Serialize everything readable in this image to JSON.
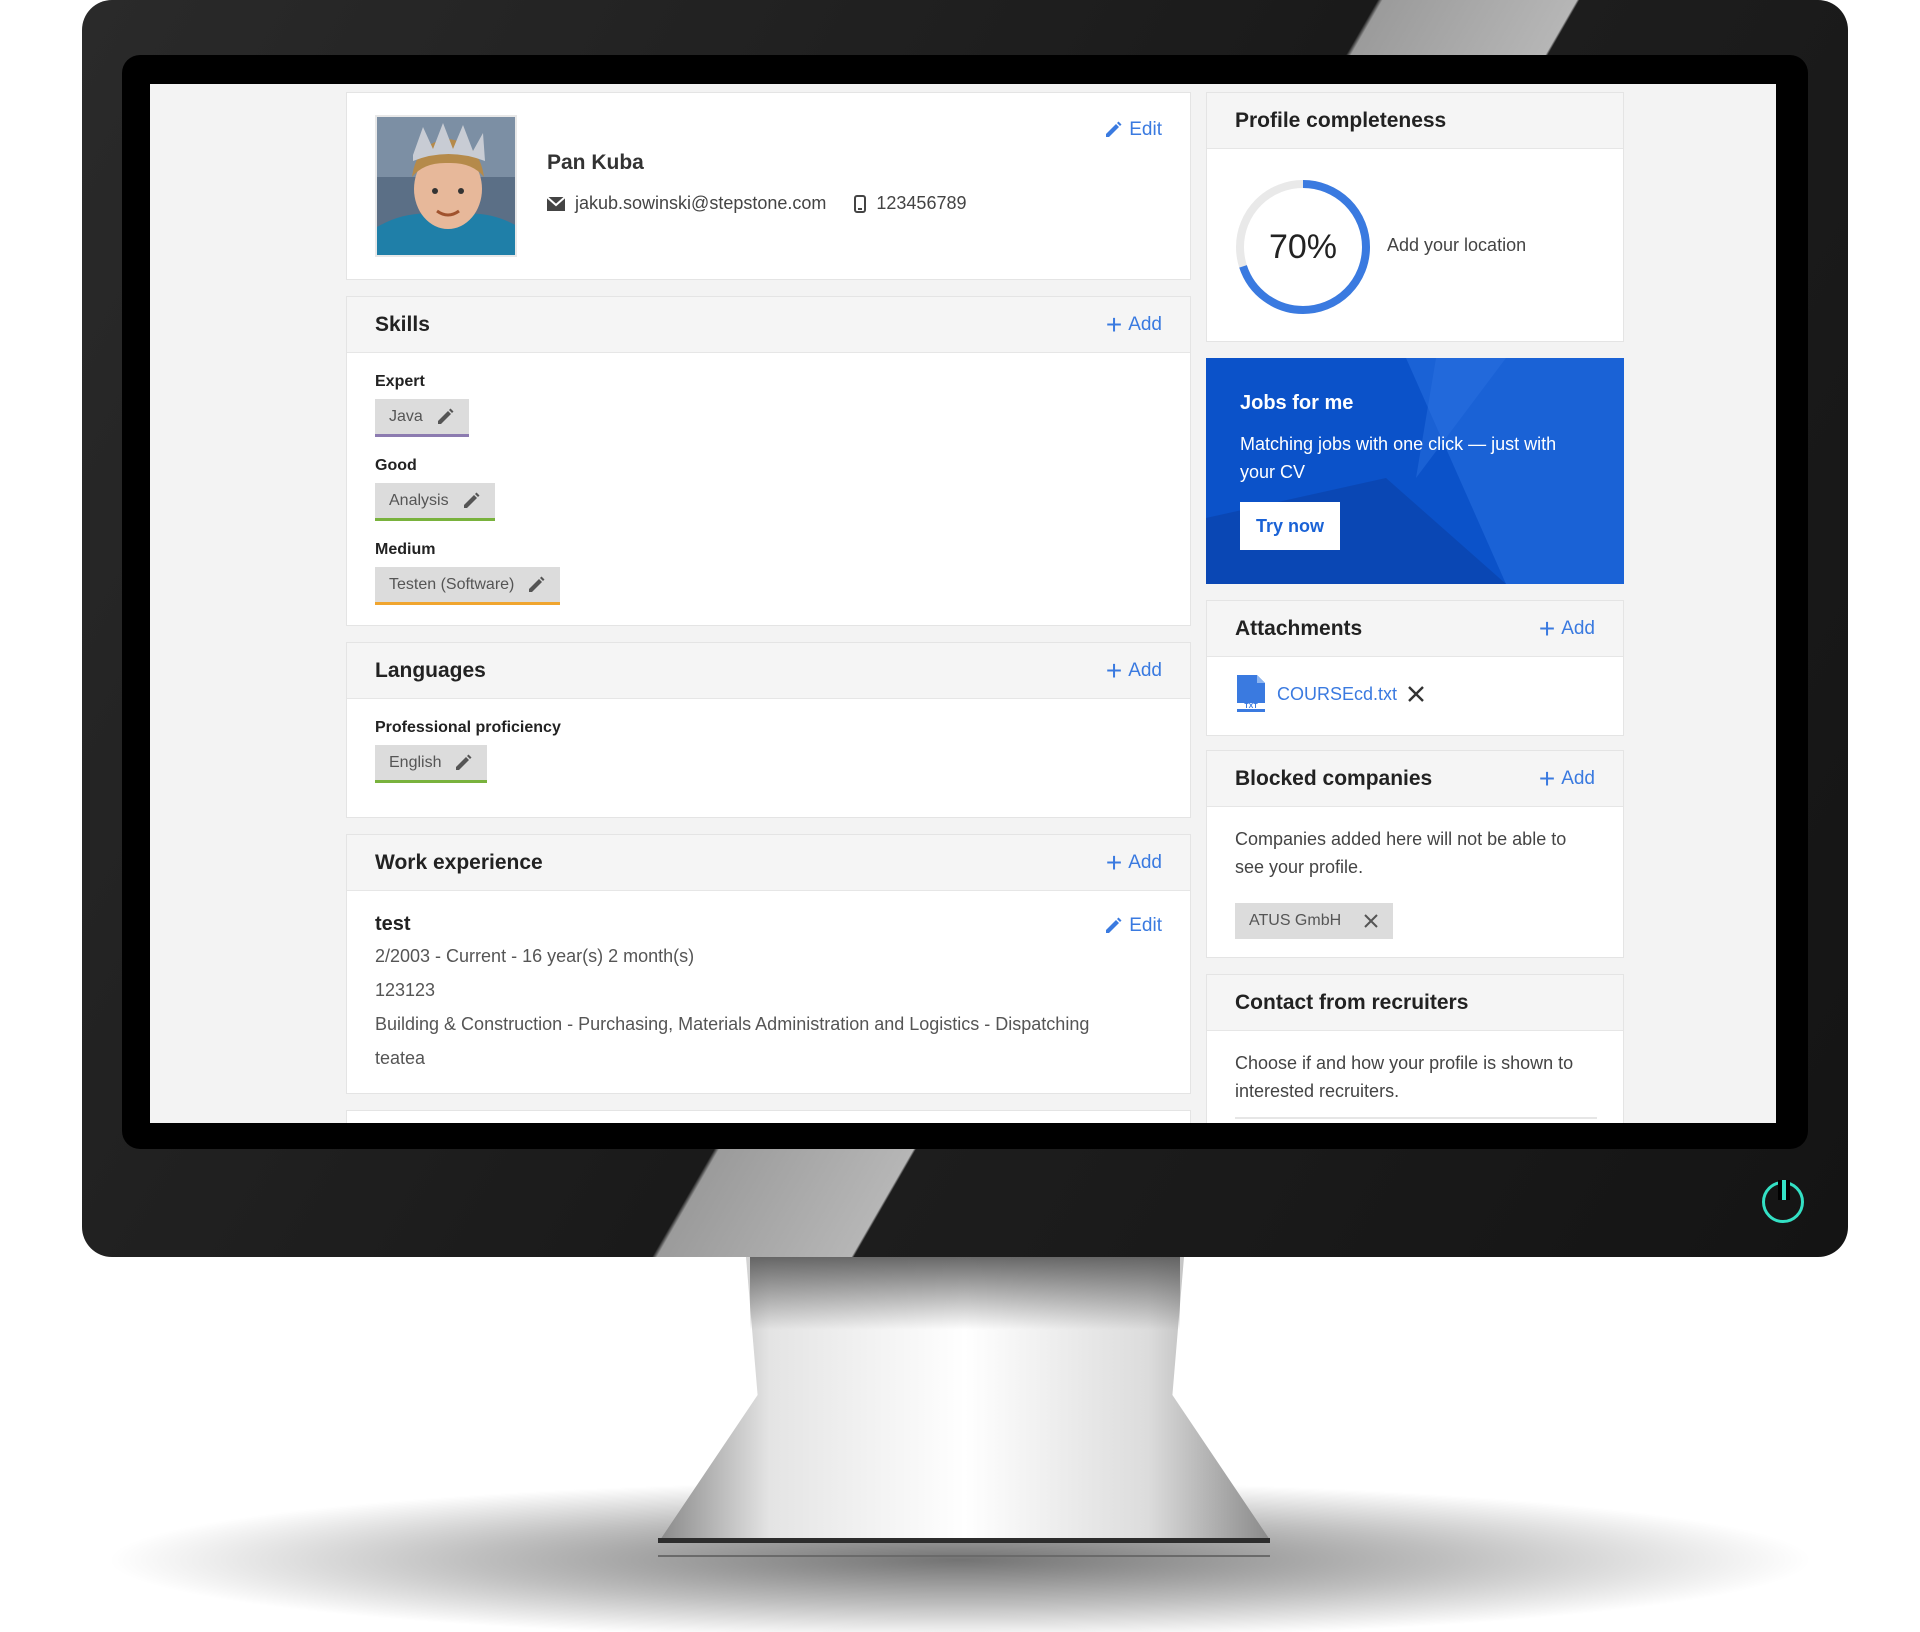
{
  "profile": {
    "name": "Pan Kuba",
    "email": "jakub.sowinski@stepstone.com",
    "phone": "123456789",
    "edit_label": "Edit"
  },
  "skills": {
    "title": "Skills",
    "add_label": "Add",
    "groups": [
      {
        "level": "Expert",
        "skill": "Java",
        "color": "#8c7bb0"
      },
      {
        "level": "Good",
        "skill": "Analysis",
        "color": "#79b23d"
      },
      {
        "level": "Medium",
        "skill": "Testen (Software)",
        "color": "#f0a52f"
      }
    ]
  },
  "languages": {
    "title": "Languages",
    "add_label": "Add",
    "level": "Professional proficiency",
    "language": "English",
    "color": "#79b23d"
  },
  "work": {
    "title": "Work experience",
    "add_label": "Add",
    "edit_label": "Edit",
    "job_title": "test",
    "period": "2/2003 - Current - 16 year(s) 2 month(s)",
    "company": "123123",
    "field": "Building & Construction - Purchasing, Materials Administration and Logistics - Dispatching",
    "description": "teatea"
  },
  "completeness": {
    "title": "Profile completeness",
    "percent_label": "70%",
    "percent": 70,
    "hint": "Add your location",
    "accent": "#3a7ae0"
  },
  "jobs": {
    "title": "Jobs for me",
    "text": "Matching jobs with one click — just with your CV",
    "button": "Try now",
    "bg": "#0b52c9"
  },
  "attachments": {
    "title": "Attachments",
    "add_label": "Add",
    "file_name": "COURSEcd.txt",
    "file_type": "TXT"
  },
  "blocked": {
    "title": "Blocked companies",
    "add_label": "Add",
    "text": "Companies added here will not be able to see your profile.",
    "company": "ATUS GmbH"
  },
  "recruiters": {
    "title": "Contact from recruiters",
    "text": "Choose if and how your profile is shown to interested recruiters."
  }
}
